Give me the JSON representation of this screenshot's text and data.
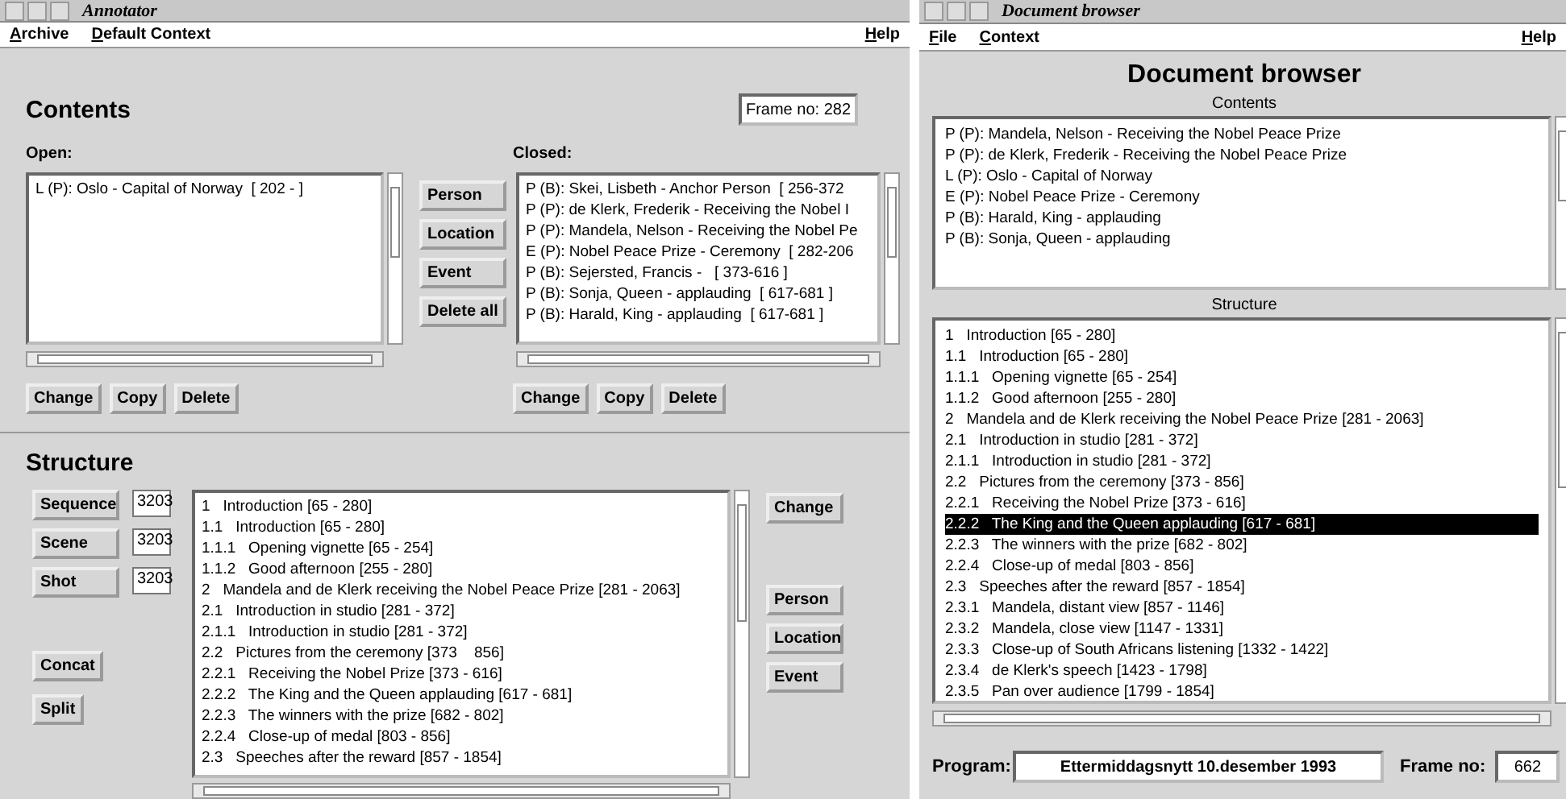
{
  "annotator": {
    "title": "Annotator",
    "menu": [
      "Archive",
      "Default Context"
    ],
    "help": "Help",
    "contents": {
      "heading": "Contents",
      "frame": "Frame no: 282",
      "open_label": "Open:",
      "open_items": [
        "L (P): Oslo - Capital of Norway  [ 202 - ]"
      ],
      "type_buttons": [
        "Person",
        "Location",
        "Event",
        "Delete all"
      ],
      "closed_label": "Closed:",
      "closed_items": [
        "P (B): Skei, Lisbeth - Anchor Person  [ 256-372",
        "P (P): de Klerk, Frederik - Receiving the Nobel I",
        "P (P): Mandela, Nelson - Receiving the Nobel Pe",
        "E (P): Nobel Peace Prize - Ceremony  [ 282-206",
        "P (B): Sejersted, Francis -   [ 373-616 ]",
        "P (B): Sonja, Queen - applauding  [ 617-681 ]",
        "P (B): Harald, King - applauding  [ 617-681 ]"
      ],
      "open_actions": [
        "Change",
        "Copy",
        "Delete"
      ],
      "closed_actions": [
        "Change",
        "Copy",
        "Delete"
      ]
    },
    "structure": {
      "heading": "Structure",
      "levels": [
        {
          "button": "Sequence",
          "value": "3203"
        },
        {
          "button": "Scene",
          "value": "3203"
        },
        {
          "button": "Shot",
          "value": "3203"
        }
      ],
      "edit_buttons": [
        "Concat",
        "Split"
      ],
      "items": [
        {
          "text": "1   Introduction [65 - 280]",
          "children": [
            {
              "text": "1.1   Introduction [65 - 280]",
              "children": [
                {
                  "text": "1.1.1   Opening vignette [65 - 254]"
                },
                {
                  "text": "1.1.2   Good afternoon [255 - 280]"
                }
              ]
            }
          ]
        },
        {
          "text": "2   Mandela and de Klerk receiving the Nobel Peace Prize [281 - 2063]",
          "children": [
            {
              "text": "2.1   Introduction in studio [281 - 372]",
              "children": [
                {
                  "text": "2.1.1   Introduction in studio [281 - 372]"
                }
              ]
            },
            {
              "text": "2.2   Pictures from the ceremony [373    856]",
              "children": [
                {
                  "text": "2.2.1   Receiving the Nobel Prize [373 - 616]"
                },
                {
                  "text": "2.2.2   The King and the Queen applauding [617 - 681]"
                },
                {
                  "text": "2.2.3   The winners with the prize [682 - 802]"
                },
                {
                  "text": "2.2.4   Close-up of medal [803 - 856]"
                }
              ]
            },
            {
              "text": "2.3   Speeches after the reward [857 - 1854]"
            }
          ]
        }
      ],
      "side_buttons": [
        "Change"
      ],
      "type_buttons": [
        "Person",
        "Location",
        "Event"
      ]
    }
  },
  "browser": {
    "title": "Document browser",
    "menu": [
      "File",
      "Context"
    ],
    "help": "Help",
    "heading": "Document browser",
    "contents_label": "Contents",
    "contents": [
      "P (P): Mandela, Nelson - Receiving the Nobel Peace Prize",
      "P (P): de Klerk, Frederik - Receiving the Nobel Peace Prize",
      "L (P): Oslo - Capital of Norway",
      "E (P): Nobel Peace Prize - Ceremony",
      "P (B): Harald, King - applauding",
      "P (B): Sonja, Queen - applauding"
    ],
    "structure_label": "Structure",
    "structure": [
      {
        "text": "1   Introduction [65 - 280]",
        "selected": false,
        "children": [
          {
            "text": "1.1   Introduction [65 - 280]",
            "selected": false,
            "children": [
              {
                "text": "1.1.1   Opening vignette [65 - 254]",
                "selected": false
              },
              {
                "text": "1.1.2   Good afternoon [255 - 280]",
                "selected": false
              }
            ]
          }
        ]
      },
      {
        "text": "2   Mandela and de Klerk receiving the Nobel Peace Prize [281 - 2063]",
        "selected": false,
        "children": [
          {
            "text": "2.1   Introduction in studio [281 - 372]",
            "selected": false,
            "children": [
              {
                "text": "2.1.1   Introduction in studio [281 - 372]",
                "selected": false
              }
            ]
          },
          {
            "text": "2.2   Pictures from the ceremony [373 - 856]",
            "selected": false,
            "children": [
              {
                "text": "2.2.1   Receiving the Nobel Prize [373 - 616]",
                "selected": false
              },
              {
                "text": "2.2.2   The King and the Queen applauding [617 - 681]",
                "selected": true
              },
              {
                "text": "2.2.3   The winners with the prize [682 - 802]",
                "selected": false
              },
              {
                "text": "2.2.4   Close-up of medal [803 - 856]",
                "selected": false
              }
            ]
          },
          {
            "text": "2.3   Speeches after the reward [857 - 1854]",
            "selected": false,
            "children": [
              {
                "text": "2.3.1   Mandela, distant view [857 - 1146]",
                "selected": false
              },
              {
                "text": "2.3.2   Mandela, close view [1147 - 1331]",
                "selected": false
              },
              {
                "text": "2.3.3   Close-up of South Africans listening [1332 - 1422]",
                "selected": false
              },
              {
                "text": "2.3.4   de Klerk's speech [1423 - 1798]",
                "selected": false
              },
              {
                "text": "2.3.5   Pan over audience [1799 - 1854]",
                "selected": false
              }
            ]
          }
        ]
      }
    ],
    "program_label": "Program:",
    "program": "Ettermiddagsnytt 10.desember 1993",
    "frame_label": "Frame no:",
    "frame": "662"
  }
}
